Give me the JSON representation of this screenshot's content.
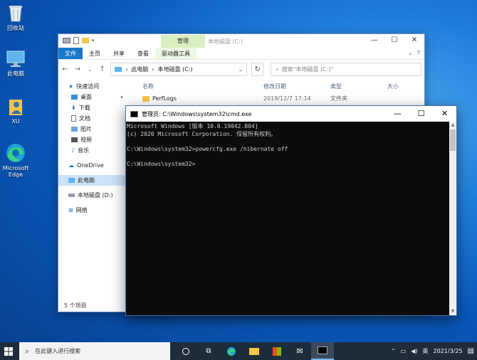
{
  "desktop": {
    "icons": [
      {
        "label": "回收站",
        "icon": "recycle-bin-icon"
      },
      {
        "label": "此电脑",
        "icon": "computer-icon"
      },
      {
        "label": "XU",
        "icon": "user-folder-icon"
      },
      {
        "label": "Microsoft Edge",
        "icon": "edge-icon"
      }
    ]
  },
  "explorer": {
    "context_tab": "管理",
    "title": "本地磁盘 (C:)",
    "ribbon_tabs": [
      "文件",
      "主页",
      "共享",
      "查看",
      "驱动器工具"
    ],
    "address": {
      "crumb1": "此电脑",
      "crumb2": "本地磁盘 (C:)"
    },
    "search_placeholder": "搜索\"本地磁盘 (C:)\"",
    "nav": {
      "quick_access": "快速访问",
      "quick_items": [
        "桌面",
        "下载",
        "文档",
        "图片",
        "视频",
        "音乐"
      ],
      "onedrive": "OneDrive",
      "this_pc": "此电脑",
      "local_disk_d": "本地磁盘 (D:)",
      "network": "网络"
    },
    "columns": [
      "名称",
      "修改日期",
      "类型",
      "大小"
    ],
    "rows": [
      {
        "name": "PerfLogs",
        "modified": "2019/12/7 17:14",
        "type": "文件夹",
        "size": ""
      }
    ],
    "status": "5 个项目"
  },
  "cmd": {
    "title": "管理员: C:\\Windows\\system32\\cmd.exe",
    "lines": [
      "Microsoft Windows [版本 10.0.19042.804]",
      "(c) 2020 Microsoft Corporation. 保留所有权利。",
      "",
      "C:\\Windows\\system32>powercfg.exe /hibernate off",
      "",
      "C:\\Windows\\system32>"
    ]
  },
  "taskbar": {
    "search_placeholder": "在此键入进行搜索",
    "apps": [
      "task-view-icon",
      "edge-icon",
      "file-explorer-icon",
      "store-icon",
      "mail-icon",
      "cmd-icon"
    ],
    "tray": {
      "ime": "英",
      "time": "",
      "date": "2021/3/25"
    }
  },
  "colors": {
    "accent": "#1979ca",
    "ctx_tab": "#d9efc0",
    "console_bg": "#0c0c0c",
    "taskbar": "#1d2b3a"
  }
}
